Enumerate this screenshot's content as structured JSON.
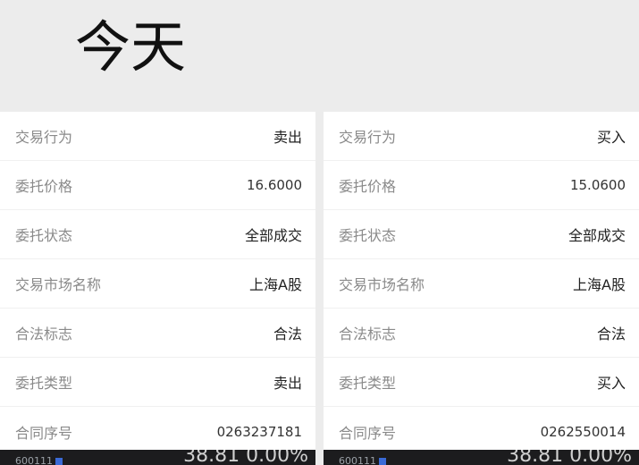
{
  "header": {
    "title": "今天"
  },
  "panels": [
    {
      "rows": [
        {
          "label": "交易行为",
          "value": "卖出"
        },
        {
          "label": "委托价格",
          "value": "16.6000"
        },
        {
          "label": "委托状态",
          "value": "全部成交"
        },
        {
          "label": "交易市场名称",
          "value": "上海A股"
        },
        {
          "label": "合法标志",
          "value": "合法"
        },
        {
          "label": "委托类型",
          "value": "卖出"
        },
        {
          "label": "合同序号",
          "value": "0263237181"
        }
      ],
      "footer": {
        "code": "600111",
        "price": "38.81  0.00%"
      }
    },
    {
      "rows": [
        {
          "label": "交易行为",
          "value": "买入"
        },
        {
          "label": "委托价格",
          "value": "15.0600"
        },
        {
          "label": "委托状态",
          "value": "全部成交"
        },
        {
          "label": "交易市场名称",
          "value": "上海A股"
        },
        {
          "label": "合法标志",
          "value": "合法"
        },
        {
          "label": "委托类型",
          "value": "买入"
        },
        {
          "label": "合同序号",
          "value": "0262550014"
        }
      ],
      "footer": {
        "code": "600111",
        "price": "38.81  0.00%"
      }
    }
  ]
}
